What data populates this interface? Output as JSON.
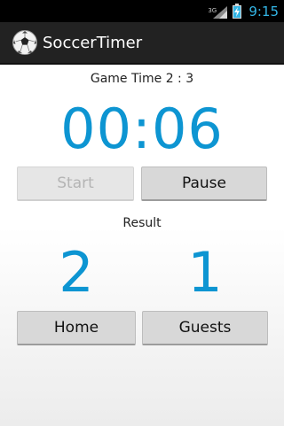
{
  "status_bar": {
    "network_type": "3G",
    "time": "9:15",
    "icons": [
      "signal-icon",
      "battery-charging-icon"
    ]
  },
  "action_bar": {
    "title": "SoccerTimer",
    "icon": "soccer-ball-icon"
  },
  "main": {
    "game_time_label": "Game Time 2 : 3",
    "timer_value": "00:06",
    "start_label": "Start",
    "start_enabled": false,
    "pause_label": "Pause",
    "result_label": "Result",
    "home_score": "2",
    "guests_score": "1",
    "home_label": "Home",
    "guests_label": "Guests"
  },
  "colors": {
    "accent": "#0d95d2",
    "clock": "#33b5e5",
    "action_bar": "#222222"
  }
}
